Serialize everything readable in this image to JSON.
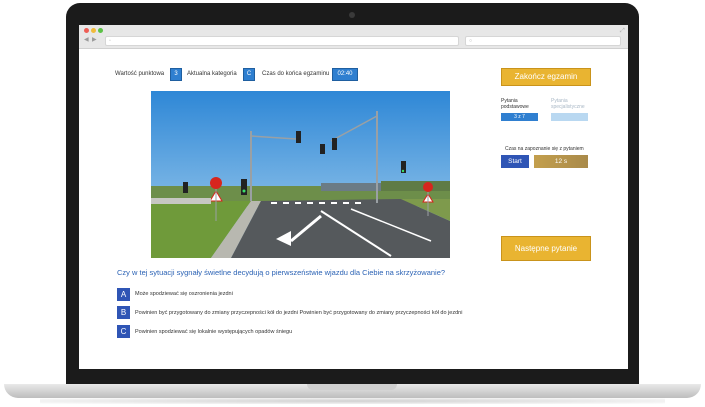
{
  "exam": {
    "points_label": "Wartość punktowa",
    "points_value": "3",
    "category_label": "Aktualna kategoria",
    "category_value": "C",
    "time_label": "Czas do końca egzaminu",
    "time_value": "02:40"
  },
  "question": {
    "text": "Czy w tej sytuacji sygnały świetlne decydują o pierwszeństwie wjazdu dla Ciebie na skrzyżowanie?",
    "options": [
      {
        "letter": "A",
        "text": "Może spodziewać się oszronienia jezdni"
      },
      {
        "letter": "B",
        "text": "Powinien być przygotowany do zmiany przyczepności kół do jezdni Powinien być przygotowany do zmiany przyczepności kół do jezdni"
      },
      {
        "letter": "C",
        "text": "Powinien spodziewać się lokalnie występujących opadów śniegu"
      }
    ]
  },
  "sidebar": {
    "end_button": "Zakończ egzamin",
    "basic_label": "Pytania podstawowe",
    "basic_value": "3 z 7",
    "special_label": "Pytania specjalistyczne",
    "special_value": "",
    "prep_label": "Czas na zapoznanie się z pytaniem",
    "start_button": "Start",
    "timer_value": "12 s",
    "next_button": "Następne pytanie"
  },
  "colors": {
    "accent_blue": "#2f7fd0",
    "button_gold": "#e9b431",
    "option_blue": "#2f55b5",
    "question_blue": "#2c63b5"
  }
}
